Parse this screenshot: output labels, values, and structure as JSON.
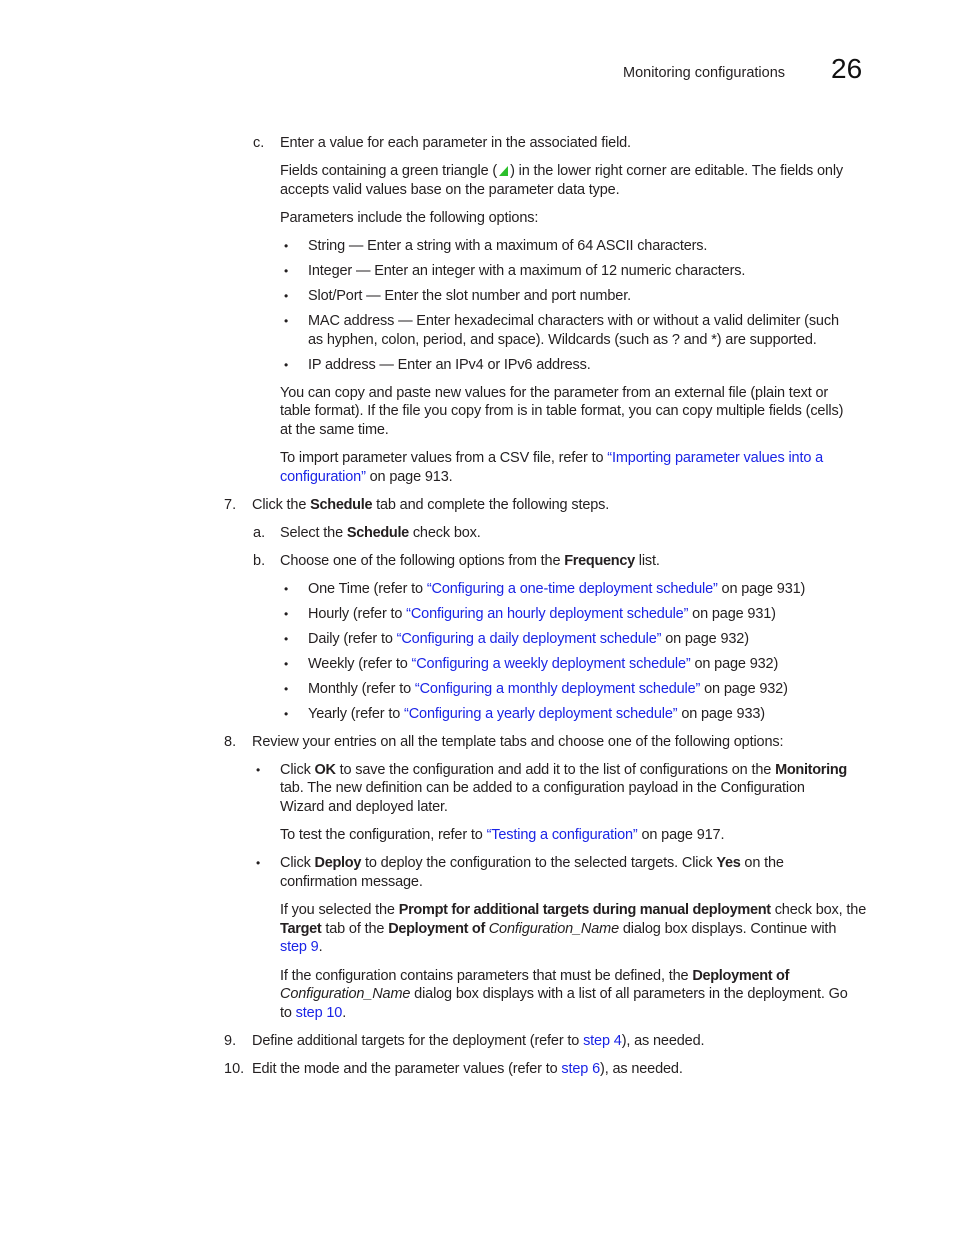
{
  "header": {
    "section_title": "Monitoring configurations",
    "chapter_number": "26"
  },
  "step_c": {
    "marker": "c.",
    "text": "Enter a value for each parameter in the associated field.",
    "fields_text_before": "Fields containing a green triangle (",
    "fields_text_after": ") in the lower right corner are editable. The fields only",
    "fields_text_line2": "accepts valid values base on the parameter data type.",
    "triangle_icon": "green-triangle-icon",
    "triangle_color": "#2bbf2b",
    "params_intro": "Parameters include the following options:",
    "params": [
      {
        "lines": [
          "String — Enter a string with a maximum of 64 ASCII characters."
        ]
      },
      {
        "lines": [
          "Integer — Enter an integer with a maximum of 12 numeric characters."
        ]
      },
      {
        "lines": [
          "Slot/Port — Enter the slot number and port number."
        ]
      },
      {
        "lines": [
          "MAC address — Enter hexadecimal characters with or without a valid delimiter (such",
          "as hyphen, colon, period, and space). Wildcards (such as ? and *) are supported."
        ]
      },
      {
        "lines": [
          "IP address — Enter an IPv4 or IPv6 address."
        ]
      }
    ],
    "copy_paste_lines": [
      "You can copy and paste new values for the parameter from an external file (plain text or",
      "table format). If the file you copy from is in table format, you can copy multiple fields (cells)",
      "at the same time."
    ],
    "import_prefix": "To import parameter values from a CSV file, refer to ",
    "import_link_line1": "“Importing parameter values into a",
    "import_link_line2": "configuration”",
    "import_suffix": " on page 913."
  },
  "step7": {
    "marker": "7.",
    "pre": "Click the ",
    "bold": "Schedule",
    "post": " tab and complete the following steps.",
    "sub_a": {
      "marker": "a.",
      "pre": "Select the ",
      "bold": "Schedule",
      "post": " check box."
    },
    "sub_b": {
      "marker": "b.",
      "pre": "Choose one of the following options from the ",
      "bold": "Frequency",
      "post": " list."
    },
    "frequencies": [
      {
        "name": "One Time (refer to ",
        "link": "“Configuring a one-time deployment schedule”",
        "page": " on page 931)"
      },
      {
        "name": "Hourly (refer to ",
        "link": "“Configuring an hourly deployment schedule”",
        "page": " on page 931)"
      },
      {
        "name": "Daily (refer to ",
        "link": "“Configuring a daily deployment schedule”",
        "page": " on page 932)"
      },
      {
        "name": "Weekly (refer to ",
        "link": "“Configuring a weekly deployment schedule”",
        "page": " on page 932)"
      },
      {
        "name": "Monthly (refer to ",
        "link": "“Configuring a monthly deployment schedule”",
        "page": " on page 932)"
      },
      {
        "name": "Yearly (refer to ",
        "link": "“Configuring a yearly deployment schedule”",
        "page": " on page 933)"
      }
    ]
  },
  "step8": {
    "marker": "8.",
    "text": "Review your entries on all the template tabs and choose one of the following options:",
    "ok": {
      "pre": "Click ",
      "bold1": "OK",
      "mid": " to save the configuration and add it to the list of configurations on the ",
      "bold2": "Monitoring",
      "line2": "tab. The new definition can be added to a configuration payload in the Configuration",
      "line3": "Wizard and deployed later.",
      "test_pre": "To test the configuration, refer to ",
      "test_link": "“Testing a configuration”",
      "test_post": " on page 917."
    },
    "deploy": {
      "pre": "Click ",
      "bold1": "Deploy",
      "mid": " to deploy the configuration to the selected targets. Click ",
      "bold2": "Yes",
      "post": " on the",
      "line2": "confirmation message.",
      "p1_pre": "If you selected the ",
      "p1_bold": "Prompt for additional targets during manual deployment",
      "p1_post": " check box, the",
      "p1_l2_bold1": "Target",
      "p1_l2_mid": " tab of the ",
      "p1_l2_bold2": "Deployment of ",
      "p1_l2_ital": "Configuration_Name",
      "p1_l2_post": " dialog box displays. Continue with",
      "p1_link": "step 9",
      "p1_end": ".",
      "p2_pre": "If the configuration contains parameters that must be defined, the ",
      "p2_bold": "Deployment of",
      "p2_l2_ital": "Configuration_Name",
      "p2_l2_post": " dialog box displays with a list of all parameters in the deployment. Go",
      "p2_l3_pre": "to ",
      "p2_link": "step 10",
      "p2_end": "."
    }
  },
  "step9": {
    "marker": "9.",
    "pre": "Define additional targets for the deployment (refer to ",
    "link": "step 4",
    "post": "), as needed."
  },
  "step10": {
    "marker": "10.",
    "pre": "Edit the mode and the parameter values (refer to ",
    "link": "step 6",
    "post": "), as needed."
  },
  "bullet_glyph": "•"
}
